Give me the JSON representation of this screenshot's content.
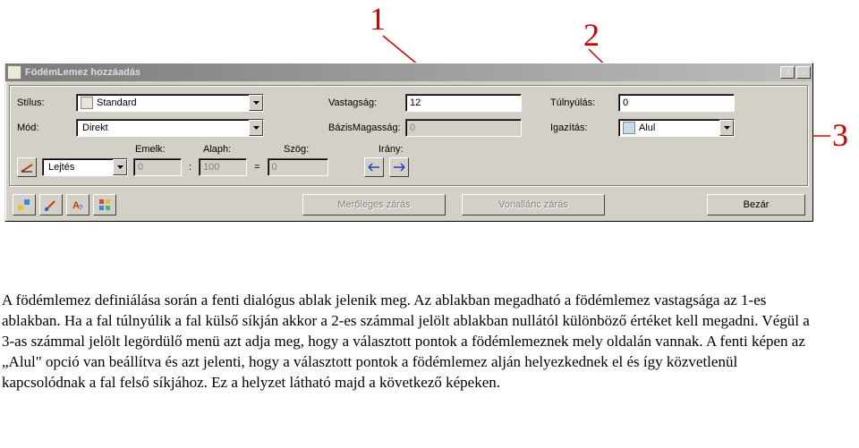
{
  "annotations": {
    "one": "1",
    "two": "2",
    "three": "3"
  },
  "titlebar": {
    "title": "FödémLemez hozzáadás",
    "help": "?",
    "close": "×"
  },
  "labels": {
    "stilus": "Stílus:",
    "vastagsag": "Vastagság:",
    "tulnyulas": "Túlnyúlás:",
    "mod": "Mód:",
    "bazismagassag": "BázisMagasság:",
    "igazitas": "Igazítás:",
    "emelk": "Emelk:",
    "alaph": "Alaph:",
    "szog": "Szög:",
    "irany": "Irány:"
  },
  "values": {
    "stilus": "Standard",
    "vastagsag": "12",
    "tulnyulas": "0",
    "mod": "Direkt",
    "bazismagassag": "0",
    "igazitas": "Alul",
    "lejtes": "Lejtés",
    "emelk": "0",
    "alaph": "100",
    "szog": "0",
    "eq": "="
  },
  "buttons": {
    "meroleges": "Merőleges zárás",
    "vonallanc": "Vonallánc zárás",
    "bezar": "Bezár"
  },
  "paragraph": "A födémlemez definiálása során a fenti dialógus ablak jelenik meg. Az ablakban megadható a födémlemez vastagsága az 1-es ablakban. Ha a fal túlnyúlik a fal külső síkján akkor a 2-es számmal jelölt ablakban nullától különböző értéket kell megadni. Végül a 3-as számmal jelölt legördülő menü azt adja meg, hogy a választott pontok a födémlemeznek mely oldalán vannak. A fenti képen az „Alul\" opció van beállítva és azt jelenti, hogy a választott pontok a födémlemez alján helyezkednek el és így közvetlenül kapcsolódnak a fal felső síkjához. Ez a helyzet látható majd a következő képeken."
}
